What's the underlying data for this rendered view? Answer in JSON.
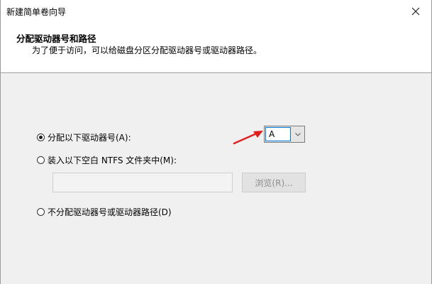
{
  "window": {
    "title": "新建简单卷向导"
  },
  "header": {
    "title": "分配驱动器号和路径",
    "description": "为了便于访问，可以给磁盘分区分配驱动器号或驱动器路径。"
  },
  "options": {
    "assign_letter": {
      "label": "分配以下驱动器号(A):",
      "selected": true
    },
    "mount_folder": {
      "label": "装入以下空白 NTFS 文件夹中(M):",
      "selected": false
    },
    "no_assign": {
      "label": "不分配驱动器号或驱动器路径(D)",
      "selected": false
    }
  },
  "drive_letter": {
    "selected_value": "A"
  },
  "folder_path": {
    "value": "",
    "browse_label": "浏览(R)..."
  },
  "icons": {
    "close": "close-icon",
    "dropdown": "chevron-down-icon",
    "annotation": "red-arrow-icon"
  },
  "colors": {
    "accent": "#0078d7",
    "annotation_red": "#e02020",
    "disabled_text": "#8c8c8c"
  }
}
